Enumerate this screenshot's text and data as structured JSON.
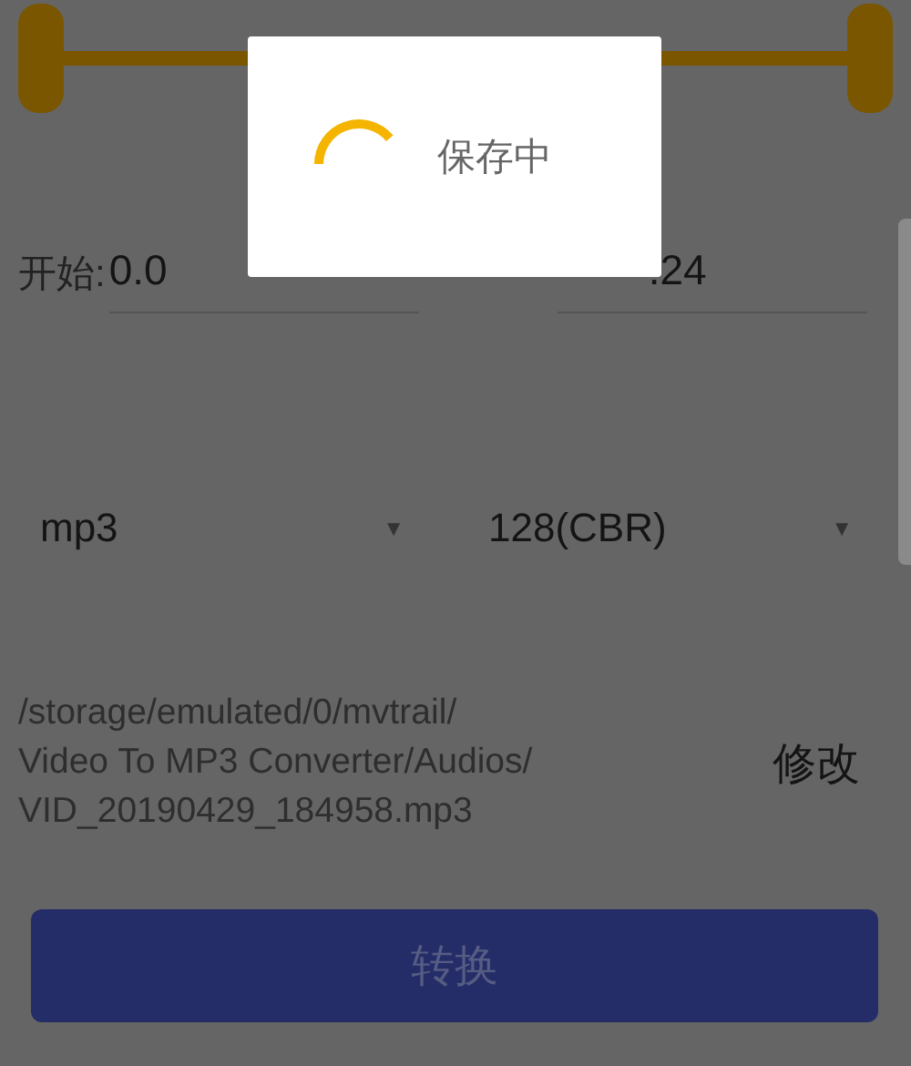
{
  "range": {
    "handles": [
      {
        "level": 0
      },
      {
        "level": 1
      }
    ]
  },
  "start_field": {
    "label": "开始:",
    "value": "0.0"
  },
  "end_field": {
    "value": ".24"
  },
  "format_dropdown": {
    "value": "mp3",
    "arrow": "▼"
  },
  "bitrate_dropdown": {
    "value": "128(CBR)",
    "arrow": "▼"
  },
  "output_path": [
    "/storage/emulated/0/mvtrail/",
    "Video To MP3 Converter/Audios/",
    "VID_20190429_184958.mp3"
  ],
  "change_button": "修改",
  "convert_button": "转换",
  "dialog": {
    "message": "保存中"
  }
}
